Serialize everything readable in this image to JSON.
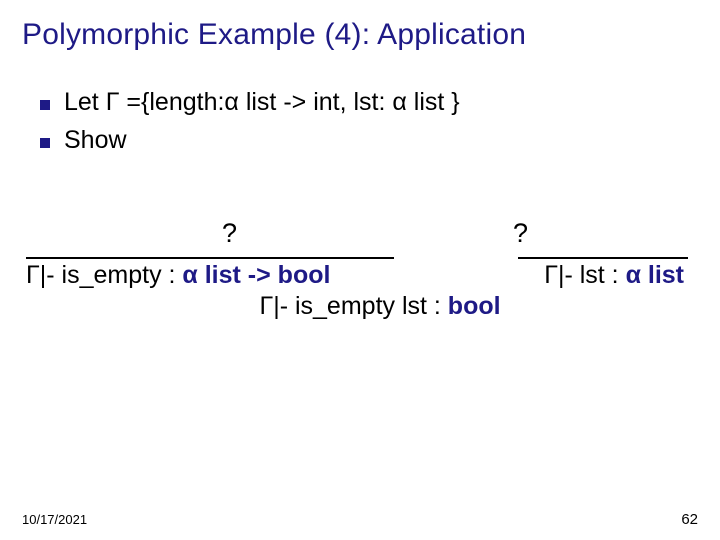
{
  "title": "Polymorphic Example (4): Application",
  "bullets": {
    "b1": "Let  Γ ={length:α list -> int,  lst: α list }",
    "b2": "Show"
  },
  "qmark_left": "?",
  "qmark_right": "?",
  "premise_left": {
    "prefix": "Γ|- is_empty : ",
    "blue": "α list -> bool"
  },
  "premise_right": {
    "prefix": "Γ|- lst : ",
    "blue": "α list"
  },
  "conclusion": {
    "prefix": "Γ|- is_empty lst : ",
    "blue": "bool"
  },
  "footer": {
    "date": "10/17/2021",
    "page": "62"
  }
}
